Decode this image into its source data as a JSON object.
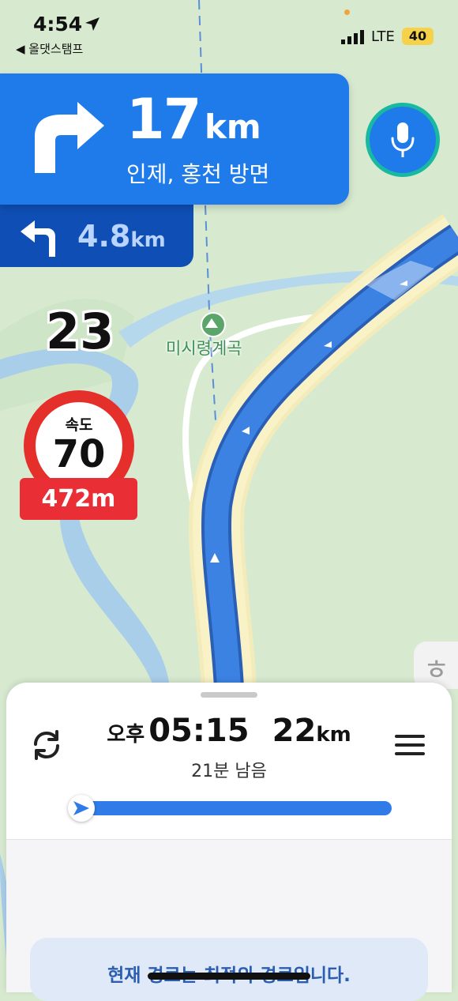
{
  "status_bar": {
    "time": "4:54",
    "back_app": "◀ 올댓스탬프",
    "network": "LTE",
    "battery": "40"
  },
  "guidance": {
    "distance_value": "17",
    "distance_unit": "km",
    "direction": "인제, 홍천 방면",
    "next_distance_value": "4.8",
    "next_distance_unit": "km"
  },
  "map": {
    "route_number": "23",
    "poi_label": "미시령계곡"
  },
  "speed_camera": {
    "label": "속도",
    "limit": "70",
    "distance": "472m"
  },
  "trip": {
    "ampm": "오후",
    "arrival_time": "05:15",
    "remaining_distance_value": "22",
    "remaining_distance_unit": "km",
    "remaining_time": "21분 남음",
    "progress": 0.02,
    "notice": "현재 경로는 최적의 경로입니다."
  },
  "colors": {
    "nav_blue": "#1f7bea",
    "next_blue": "#0f4fb5",
    "route_blue": "#2f7be8",
    "speed_red": "#e52f2a"
  }
}
